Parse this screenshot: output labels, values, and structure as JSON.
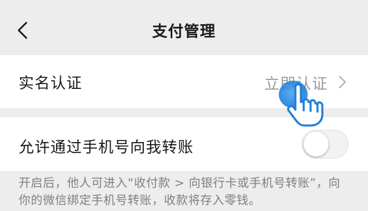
{
  "nav": {
    "title": "支付管理",
    "back_icon": "chevron-left-icon"
  },
  "real_name": {
    "label": "实名认证",
    "action": "立即认证",
    "chevron_icon": "chevron-right-icon"
  },
  "phone_transfer": {
    "label": "允许通过手机号向我转账",
    "toggle_on": false
  },
  "hint": {
    "text": "开启后，他人可进入“收付款 > 向银行卡或手机号转账”，向你的微信绑定手机号转账，收款将存入零钱。"
  },
  "overlay": {
    "cursor_icon": "hand-pointer-icon",
    "accent_color": "#1e7fd8"
  }
}
